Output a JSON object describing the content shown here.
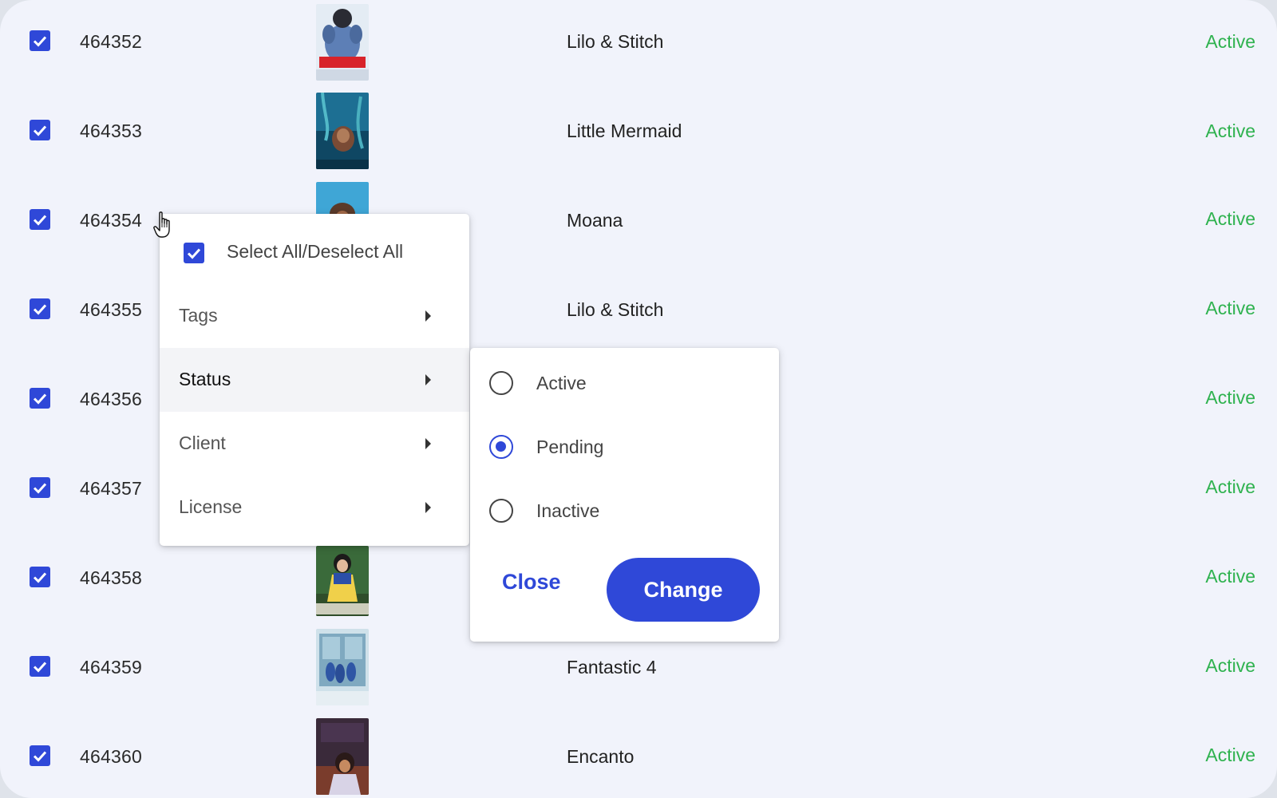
{
  "rows": [
    {
      "id": "464352",
      "title": "Lilo & Stitch",
      "status": "Active",
      "poster": "lilo-stitch-poster"
    },
    {
      "id": "464353",
      "title": "Little Mermaid",
      "status": "Active",
      "poster": "little-mermaid-poster"
    },
    {
      "id": "464354",
      "title": "Moana",
      "status": "Active",
      "poster": "moana-poster"
    },
    {
      "id": "464355",
      "title": "Lilo & Stitch",
      "status": "Active",
      "poster": "lilo-stitch-poster"
    },
    {
      "id": "464356",
      "title": "",
      "status": "Active",
      "poster": ""
    },
    {
      "id": "464357",
      "title": "",
      "status": "Active",
      "poster": ""
    },
    {
      "id": "464358",
      "title": "",
      "status": "Active",
      "poster": "snow-white-poster"
    },
    {
      "id": "464359",
      "title": "Fantastic 4",
      "status": "Active",
      "poster": "fantastic-4-poster"
    },
    {
      "id": "464360",
      "title": "Encanto",
      "status": "Active",
      "poster": "encanto-poster"
    }
  ],
  "menu": {
    "select_all": "Select All/Deselect All",
    "items": [
      {
        "label": "Tags"
      },
      {
        "label": "Status"
      },
      {
        "label": "Client"
      },
      {
        "label": "License"
      }
    ]
  },
  "status_submenu": {
    "options": [
      {
        "label": "Active",
        "selected": false
      },
      {
        "label": "Pending",
        "selected": true
      },
      {
        "label": "Inactive",
        "selected": false
      }
    ],
    "close_label": "Close",
    "change_label": "Change"
  },
  "colors": {
    "accent": "#2f48d8",
    "status_active": "#2fb24f",
    "background": "#f1f3fb"
  }
}
